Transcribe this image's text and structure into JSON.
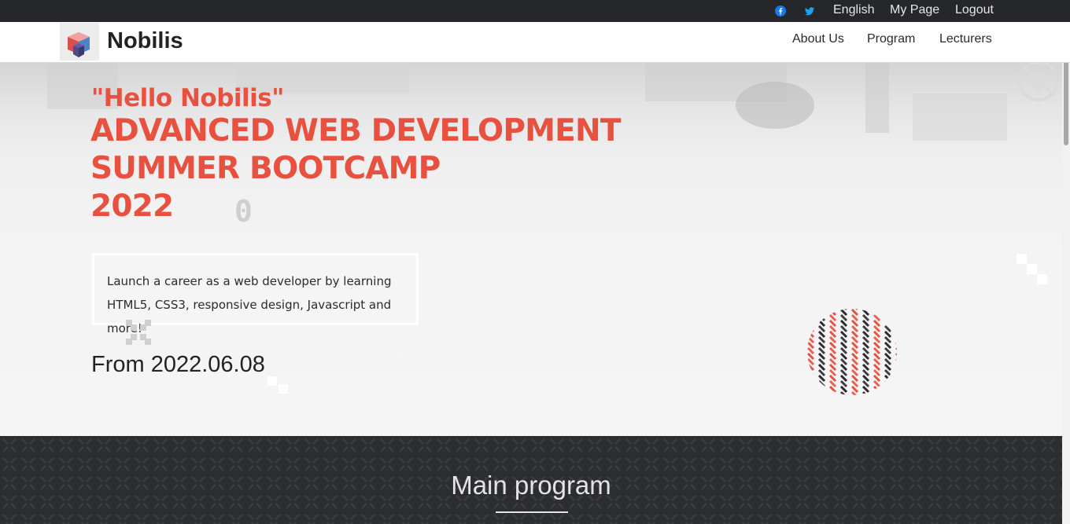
{
  "topbar": {
    "icons": [
      "facebook-icon",
      "twitter-icon"
    ],
    "language": "English",
    "my_page": "My Page",
    "logout": "Logout"
  },
  "navbar": {
    "brand": "Nobilis",
    "links": [
      "About Us",
      "Program",
      "Lecturers"
    ]
  },
  "hero": {
    "tagline": "\"Hello Nobilis\"",
    "headline_lines": [
      "ADVANCED WEB DEVELOPMENT",
      "SUMMER BOOTCAMP",
      "2022"
    ],
    "deco_glyph": "0",
    "description_lines": [
      "Launch a career as a web developer by learning",
      "HTML5, CSS3, responsive design, Javascript and more!"
    ],
    "from_date": "From 2022.06.08"
  },
  "program_section": {
    "title": "Main program"
  },
  "colors": {
    "accent": "#e8503f",
    "dark_bar": "#26272b",
    "dark_section": "#2c2d31",
    "facebook": "#1877f2",
    "twitter": "#1da1f2"
  }
}
